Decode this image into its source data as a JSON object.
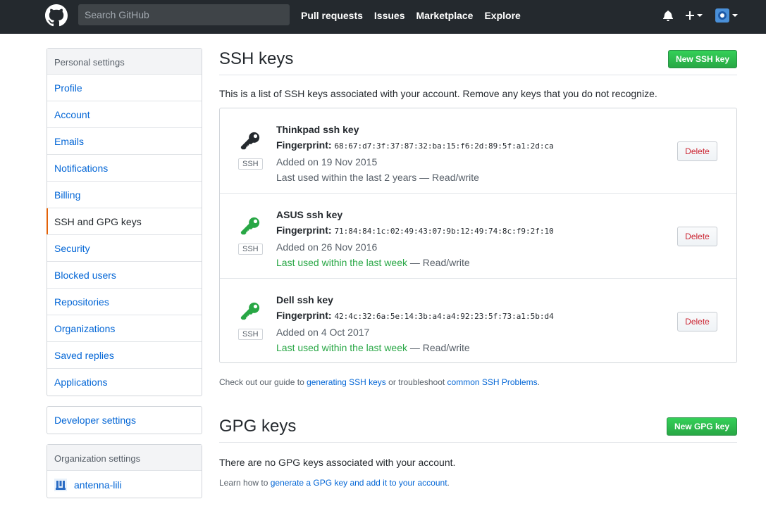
{
  "header": {
    "search_placeholder": "Search GitHub",
    "nav": [
      "Pull requests",
      "Issues",
      "Marketplace",
      "Explore"
    ]
  },
  "sidebar": {
    "personal_heading": "Personal settings",
    "items": [
      "Profile",
      "Account",
      "Emails",
      "Notifications",
      "Billing",
      "SSH and GPG keys",
      "Security",
      "Blocked users",
      "Repositories",
      "Organizations",
      "Saved replies",
      "Applications"
    ],
    "selected": "SSH and GPG keys",
    "developer_settings": "Developer settings",
    "org_heading": "Organization settings",
    "org_name": "antenna-lili"
  },
  "ssh": {
    "title": "SSH keys",
    "new_button": "New SSH key",
    "description": "This is a list of SSH keys associated with your account. Remove any keys that you do not recognize.",
    "fingerprint_label": "Fingerprint:",
    "type_label": "SSH",
    "delete_label": "Delete",
    "keys": [
      {
        "title": "Thinkpad ssh key",
        "fingerprint": "68:67:d7:3f:37:87:32:ba:15:f6:2d:89:5f:a1:2d:ca",
        "added": "Added on 19 Nov 2015",
        "last_used": "Last used within the last 2 years",
        "access": " — Read/write",
        "recent": false
      },
      {
        "title": "ASUS ssh key",
        "fingerprint": "71:84:84:1c:02:49:43:07:9b:12:49:74:8c:f9:2f:10",
        "added": "Added on 26 Nov 2016",
        "last_used": "Last used within the last week",
        "access": " — Read/write",
        "recent": true
      },
      {
        "title": "Dell ssh key",
        "fingerprint": "42:4c:32:6a:5e:14:3b:a4:a4:92:23:5f:73:a1:5b:d4",
        "added": "Added on 4 Oct 2017",
        "last_used": "Last used within the last week",
        "access": " — Read/write",
        "recent": true
      }
    ],
    "help_prefix": "Check out our guide to ",
    "help_link1": "generating SSH keys",
    "help_middle": " or troubleshoot ",
    "help_link2": "common SSH Problems",
    "help_suffix": "."
  },
  "gpg": {
    "title": "GPG keys",
    "new_button": "New GPG key",
    "description": "There are no GPG keys associated with your account.",
    "help_prefix": "Learn how to ",
    "help_link": "generate a GPG key and add it to your account",
    "help_suffix": "."
  },
  "colors": {
    "header_bg": "#24292e",
    "link": "#0366d6",
    "green": "#28a745",
    "key_dark": "#24292e",
    "danger": "#cb2431",
    "selected_bar": "#e36209"
  }
}
